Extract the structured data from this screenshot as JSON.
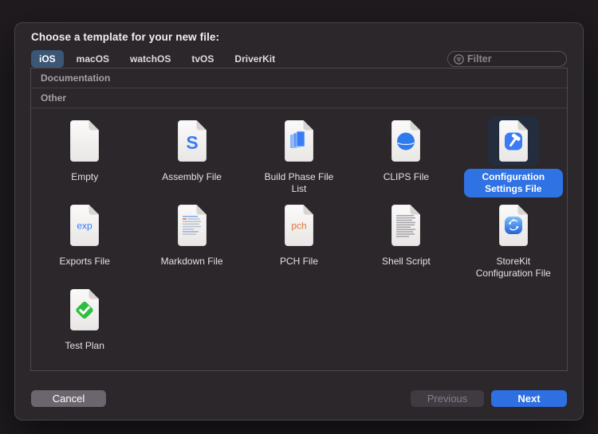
{
  "window": {
    "title": "Choose a template for your new file:"
  },
  "tabs": [
    {
      "label": "iOS",
      "selected": true
    },
    {
      "label": "macOS",
      "selected": false
    },
    {
      "label": "watchOS",
      "selected": false
    },
    {
      "label": "tvOS",
      "selected": false
    },
    {
      "label": "DriverKit",
      "selected": false
    }
  ],
  "filter": {
    "placeholder": "Filter",
    "icon": "filter-icon"
  },
  "sections": [
    {
      "label": "Documentation",
      "items": []
    },
    {
      "label": "Other",
      "items": [
        {
          "label": "Empty",
          "icon": "document-blank-icon",
          "selected": false
        },
        {
          "label": "Assembly File",
          "icon": "document-assembly-icon",
          "selected": false
        },
        {
          "label": "Build Phase File List",
          "icon": "document-pages-icon",
          "selected": false
        },
        {
          "label": "CLIPS File",
          "icon": "document-sphere-icon",
          "selected": false
        },
        {
          "label": "Configuration Settings File",
          "icon": "document-hammer-icon",
          "selected": true
        },
        {
          "label": "Exports File",
          "icon": "document-exp-icon",
          "selected": false
        },
        {
          "label": "Markdown File",
          "icon": "document-markdown-icon",
          "selected": false
        },
        {
          "label": "PCH File",
          "icon": "document-pch-icon",
          "selected": false
        },
        {
          "label": "Shell Script",
          "icon": "document-script-icon",
          "selected": false
        },
        {
          "label": "StoreKit Configuration File",
          "icon": "document-storekit-icon",
          "selected": false
        },
        {
          "label": "Test Plan",
          "icon": "document-checkmark-icon",
          "selected": false
        }
      ]
    }
  ],
  "footer": {
    "cancel_label": "Cancel",
    "previous_label": "Previous",
    "next_label": "Next"
  },
  "colors": {
    "accent_blue": "#2e6fe2",
    "selected_tab": "#3b5775",
    "selection_label": "#2f72e4",
    "selection_icon_bg": "#242d3d",
    "pch_orange": "#e0763c",
    "test_plan_green": "#2ebe3f",
    "window_bg": "#2b272b"
  }
}
